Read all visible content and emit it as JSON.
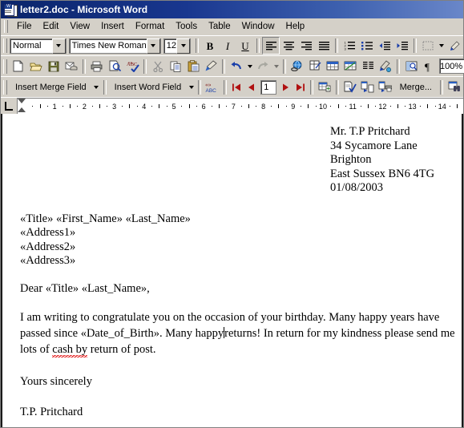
{
  "window": {
    "title": "letter2.doc - Microsoft Word",
    "icon": "word-document-icon",
    "titlebar_color": "#0a246a"
  },
  "menubar": {
    "items": [
      {
        "label": "File"
      },
      {
        "label": "Edit"
      },
      {
        "label": "View"
      },
      {
        "label": "Insert"
      },
      {
        "label": "Format"
      },
      {
        "label": "Tools"
      },
      {
        "label": "Table"
      },
      {
        "label": "Window"
      },
      {
        "label": "Help"
      }
    ]
  },
  "formatting_toolbar": {
    "style": {
      "value": "Normal",
      "name": "style-combo"
    },
    "font": {
      "value": "Times New Roman",
      "name": "font-combo"
    },
    "size": {
      "value": "12",
      "name": "font-size-combo"
    },
    "bold": "B",
    "italic": "I",
    "underline": "U",
    "buttons": [
      "align-left",
      "align-center",
      "align-right",
      "align-justify",
      "numbered-list",
      "bulleted-list",
      "decrease-indent",
      "increase-indent",
      "borders",
      "highlight"
    ],
    "active_alignment": "align-left"
  },
  "standard_toolbar": {
    "buttons": [
      "new-document",
      "open",
      "save",
      "email",
      "print",
      "print-preview",
      "spelling-grammar",
      "cut",
      "copy",
      "paste",
      "format-painter",
      "undo",
      "redo",
      "insert-hyperlink",
      "tables-and-borders",
      "insert-table",
      "insert-excel-worksheet",
      "columns",
      "drawing",
      "document-map",
      "show-formatting-marks"
    ],
    "zoom": {
      "value": "100%",
      "name": "zoom-combo"
    }
  },
  "mailmerge_toolbar": {
    "insert_merge_field": "Insert Merge Field",
    "insert_word_field": "Insert Word Field",
    "view_merged_data": "«»ABC",
    "first_record": "first-record",
    "prev_record": "previous-record",
    "record_number": "1",
    "next_record": "next-record",
    "last_record": "last-record",
    "buttons": [
      "mail-merge-helper",
      "check-errors",
      "merge-to-new-document",
      "merge-to-printer"
    ],
    "merge_label": "Merge...",
    "find_record": "find-record"
  },
  "ruler": {
    "tab_selector": "left-tab-stop",
    "ticks": [
      "1",
      "2",
      "3",
      "4",
      "5",
      "6",
      "7",
      "8",
      "9",
      "10",
      "11",
      "12",
      "13",
      "14"
    ]
  },
  "document": {
    "sender_address": [
      "Mr. T.P Pritchard",
      "34 Sycamore Lane",
      "Brighton",
      "East Sussex BN6 4TG",
      "01/08/2003"
    ],
    "merge_block": [
      "«Title» «First_Name» «Last_Name»",
      "«Address1»",
      "«Address2»",
      "«Address3»"
    ],
    "salutation": "Dear «Title» «Last_Name»,",
    "body": {
      "part1": "I am writing to congratulate you on the occasion of your birthday. Many happy years have passed since «Date_of_Birth». Many happy",
      "part2": "returns! In return for my kindness please send me lots of ",
      "misspelled": "cash by",
      "part3": " return of post."
    },
    "closing": "Yours sincerely",
    "signature": "T.P. Pritchard"
  }
}
